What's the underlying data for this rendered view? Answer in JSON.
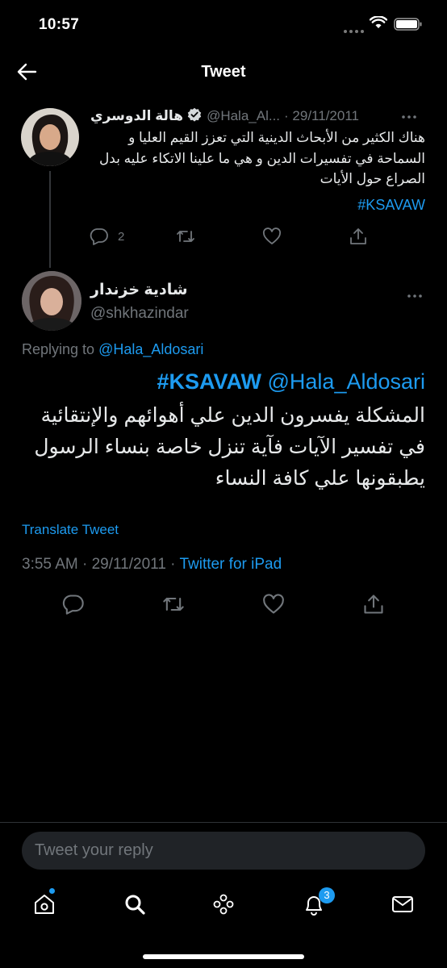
{
  "status_bar": {
    "time": "10:57"
  },
  "header": {
    "title": "Tweet"
  },
  "parent_tweet": {
    "display_name": "هالة الدوسري",
    "handle": "@Hala_Al...",
    "date": "· 29/11/2011",
    "text": "هناك الكثير من الأبحاث الدينية التي تعزز القيم العليا و السماحة في تفسيرات الدين و هي ما علينا الاتكاء عليه بدل الصراع حول الأيات",
    "hashtag": "#KSAVAW",
    "reply_count": "2"
  },
  "main_tweet": {
    "display_name": "شادية خزندار",
    "handle": "@shkhazindar",
    "replying_prefix": "Replying to",
    "replying_to": "@Hala_Aldosari",
    "hashtag": "#KSAVAW",
    "mention": "@Hala_Aldosari",
    "body": "المشكلة يفسرون الدين علي أهوائهم والإنتقائية في تفسير الآيات فآية تنزل خاصة بنساء الرسول يطبقونها علي كافة النساء",
    "translate_label": "Translate Tweet",
    "time": "3:55 AM",
    "date": "29/11/2011",
    "source": "Twitter for iPad"
  },
  "reply_bar": {
    "placeholder": "Tweet your reply"
  },
  "tab_bar": {
    "notifications_badge": "3"
  },
  "colors": {
    "accent": "#1d9bf0",
    "muted": "#71767b",
    "background": "#000000"
  }
}
